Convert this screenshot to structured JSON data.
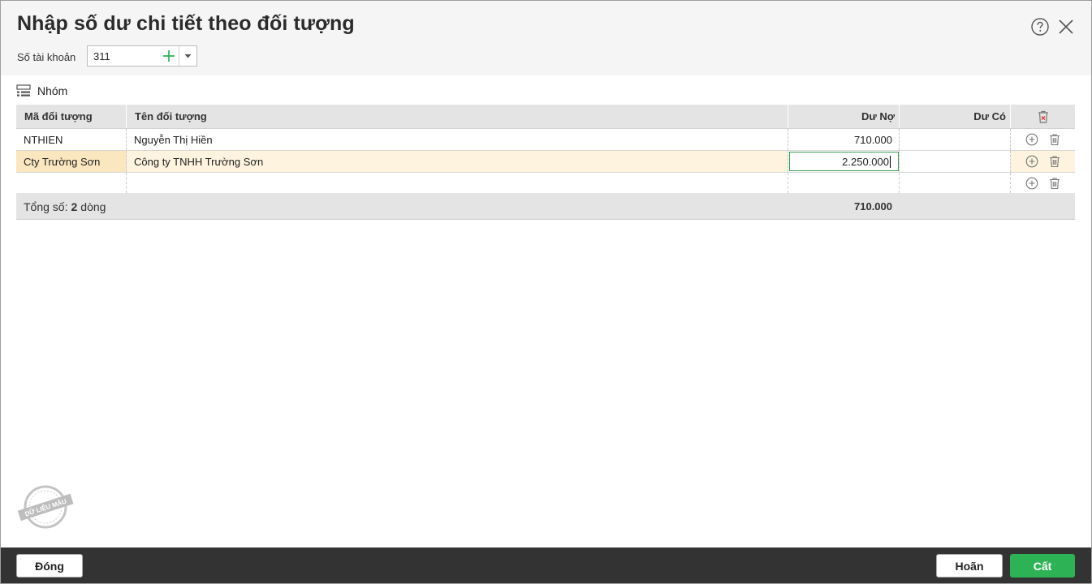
{
  "dialog": {
    "title": "Nhập số dư chi tiết theo đối tượng",
    "account_label": "Số tài khoản",
    "account_value": "311"
  },
  "toolbar": {
    "group_label": "Nhóm"
  },
  "grid": {
    "headers": {
      "code": "Mã đối tượng",
      "name": "Tên đối tượng",
      "debit": "Dư Nợ",
      "credit": "Dư Có"
    },
    "rows": [
      {
        "code": "NTHIEN",
        "name": "Nguyễn Thị Hiền",
        "debit": "710.000",
        "credit": ""
      },
      {
        "code": "Cty Trường Sơn",
        "name": "Công ty TNHH Trường Sơn",
        "debit": "2.250.000",
        "credit": ""
      },
      {
        "code": "",
        "name": "",
        "debit": "",
        "credit": ""
      }
    ],
    "summary": {
      "label_prefix": "Tổng số:",
      "count": "2",
      "label_suffix": "dòng",
      "debit_total": "710.000"
    }
  },
  "watermark": {
    "text": "DỮ LIỆU MẪU"
  },
  "footer": {
    "close_label": "Đóng",
    "cancel_label": "Hoãn",
    "save_label": "Cất"
  },
  "colors": {
    "accent": "#2db355",
    "selected_row": "#fdf3de",
    "header_bg": "#e4e4e4",
    "footer_bar": "#333333"
  }
}
